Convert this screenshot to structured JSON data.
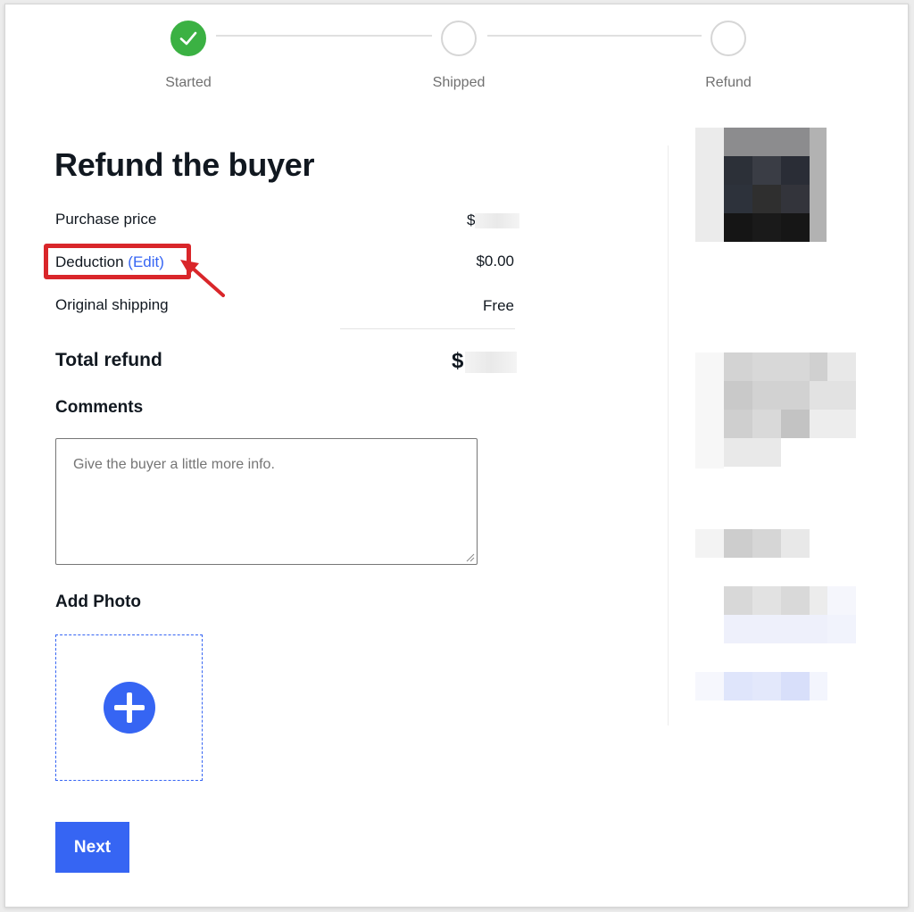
{
  "stepper": {
    "steps": [
      {
        "label": "Started",
        "state": "complete"
      },
      {
        "label": "Shipped",
        "state": "pending"
      },
      {
        "label": "Refund",
        "state": "pending"
      }
    ]
  },
  "page": {
    "title": "Refund the buyer"
  },
  "summary": {
    "purchase_price_label": "Purchase price",
    "purchase_price_value": "$",
    "deduction_label": "Deduction",
    "deduction_edit": "(Edit)",
    "deduction_value": "$0.00",
    "shipping_label": "Original shipping",
    "shipping_value": "Free",
    "total_label": "Total refund",
    "total_value": "$"
  },
  "comments": {
    "label": "Comments",
    "placeholder": "Give the buyer a little more info."
  },
  "photo": {
    "label": "Add Photo",
    "icon": "plus-circle-icon"
  },
  "actions": {
    "next_label": "Next"
  },
  "colors": {
    "accent": "#3665f3",
    "success": "#3bb143",
    "annotation": "#d9262a"
  }
}
